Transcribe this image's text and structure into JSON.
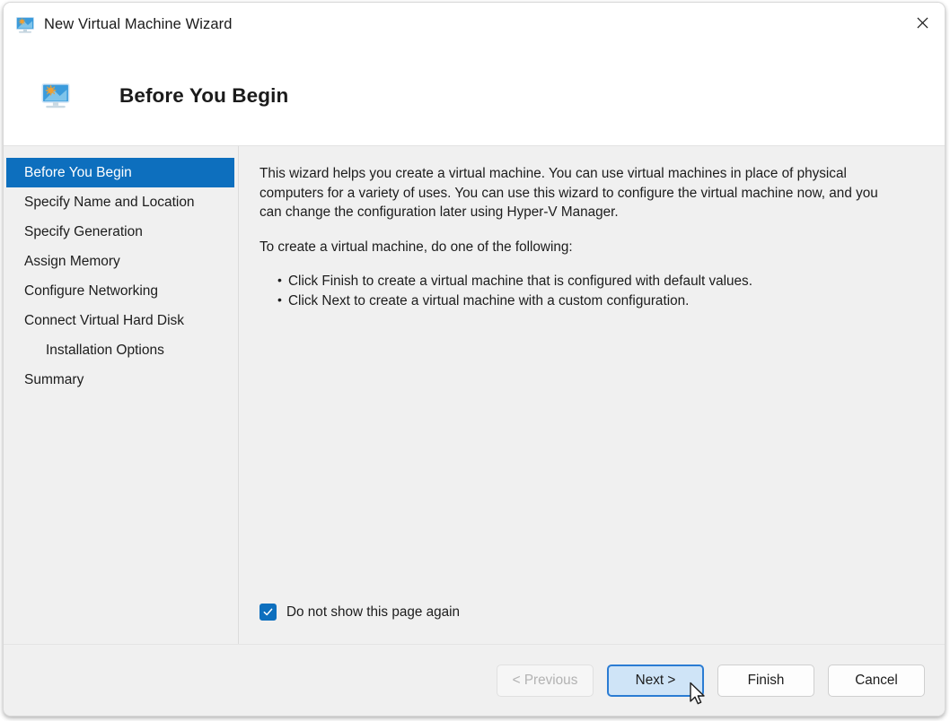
{
  "window": {
    "title": "New Virtual Machine Wizard",
    "title_icon": "virtual-machine-monitor-icon",
    "close_icon": "close-icon"
  },
  "header": {
    "title": "Before You Begin",
    "icon": "virtual-machine-monitor-icon"
  },
  "sidebar": {
    "items": [
      {
        "label": "Before You Begin",
        "selected": true,
        "indented": false
      },
      {
        "label": "Specify Name and Location",
        "selected": false,
        "indented": false
      },
      {
        "label": "Specify Generation",
        "selected": false,
        "indented": false
      },
      {
        "label": "Assign Memory",
        "selected": false,
        "indented": false
      },
      {
        "label": "Configure Networking",
        "selected": false,
        "indented": false
      },
      {
        "label": "Connect Virtual Hard Disk",
        "selected": false,
        "indented": false
      },
      {
        "label": "Installation Options",
        "selected": false,
        "indented": true
      },
      {
        "label": "Summary",
        "selected": false,
        "indented": false
      }
    ]
  },
  "content": {
    "paragraph1": "This wizard helps you create a virtual machine. You can use virtual machines in place of physical computers for a variety of uses. You can use this wizard to configure the virtual machine now, and you can change the configuration later using Hyper-V Manager.",
    "paragraph2": "To create a virtual machine, do one of the following:",
    "bullets": [
      "Click Finish to create a virtual machine that is configured with default values.",
      "Click Next to create a virtual machine with a custom configuration."
    ],
    "checkbox": {
      "label": "Do not show this page again",
      "checked": true
    }
  },
  "footer": {
    "buttons": [
      {
        "label": "< Previous",
        "state": "disabled"
      },
      {
        "label": "Next >",
        "state": "primary"
      },
      {
        "label": "Finish",
        "state": "normal"
      },
      {
        "label": "Cancel",
        "state": "normal"
      }
    ]
  },
  "colors": {
    "accent_blue": "#0d6fbe",
    "focus_border": "#2b7cd3",
    "focus_fill": "#cfe4f7",
    "body_bg": "#f0f0f0",
    "text": "#1c1c1c"
  }
}
